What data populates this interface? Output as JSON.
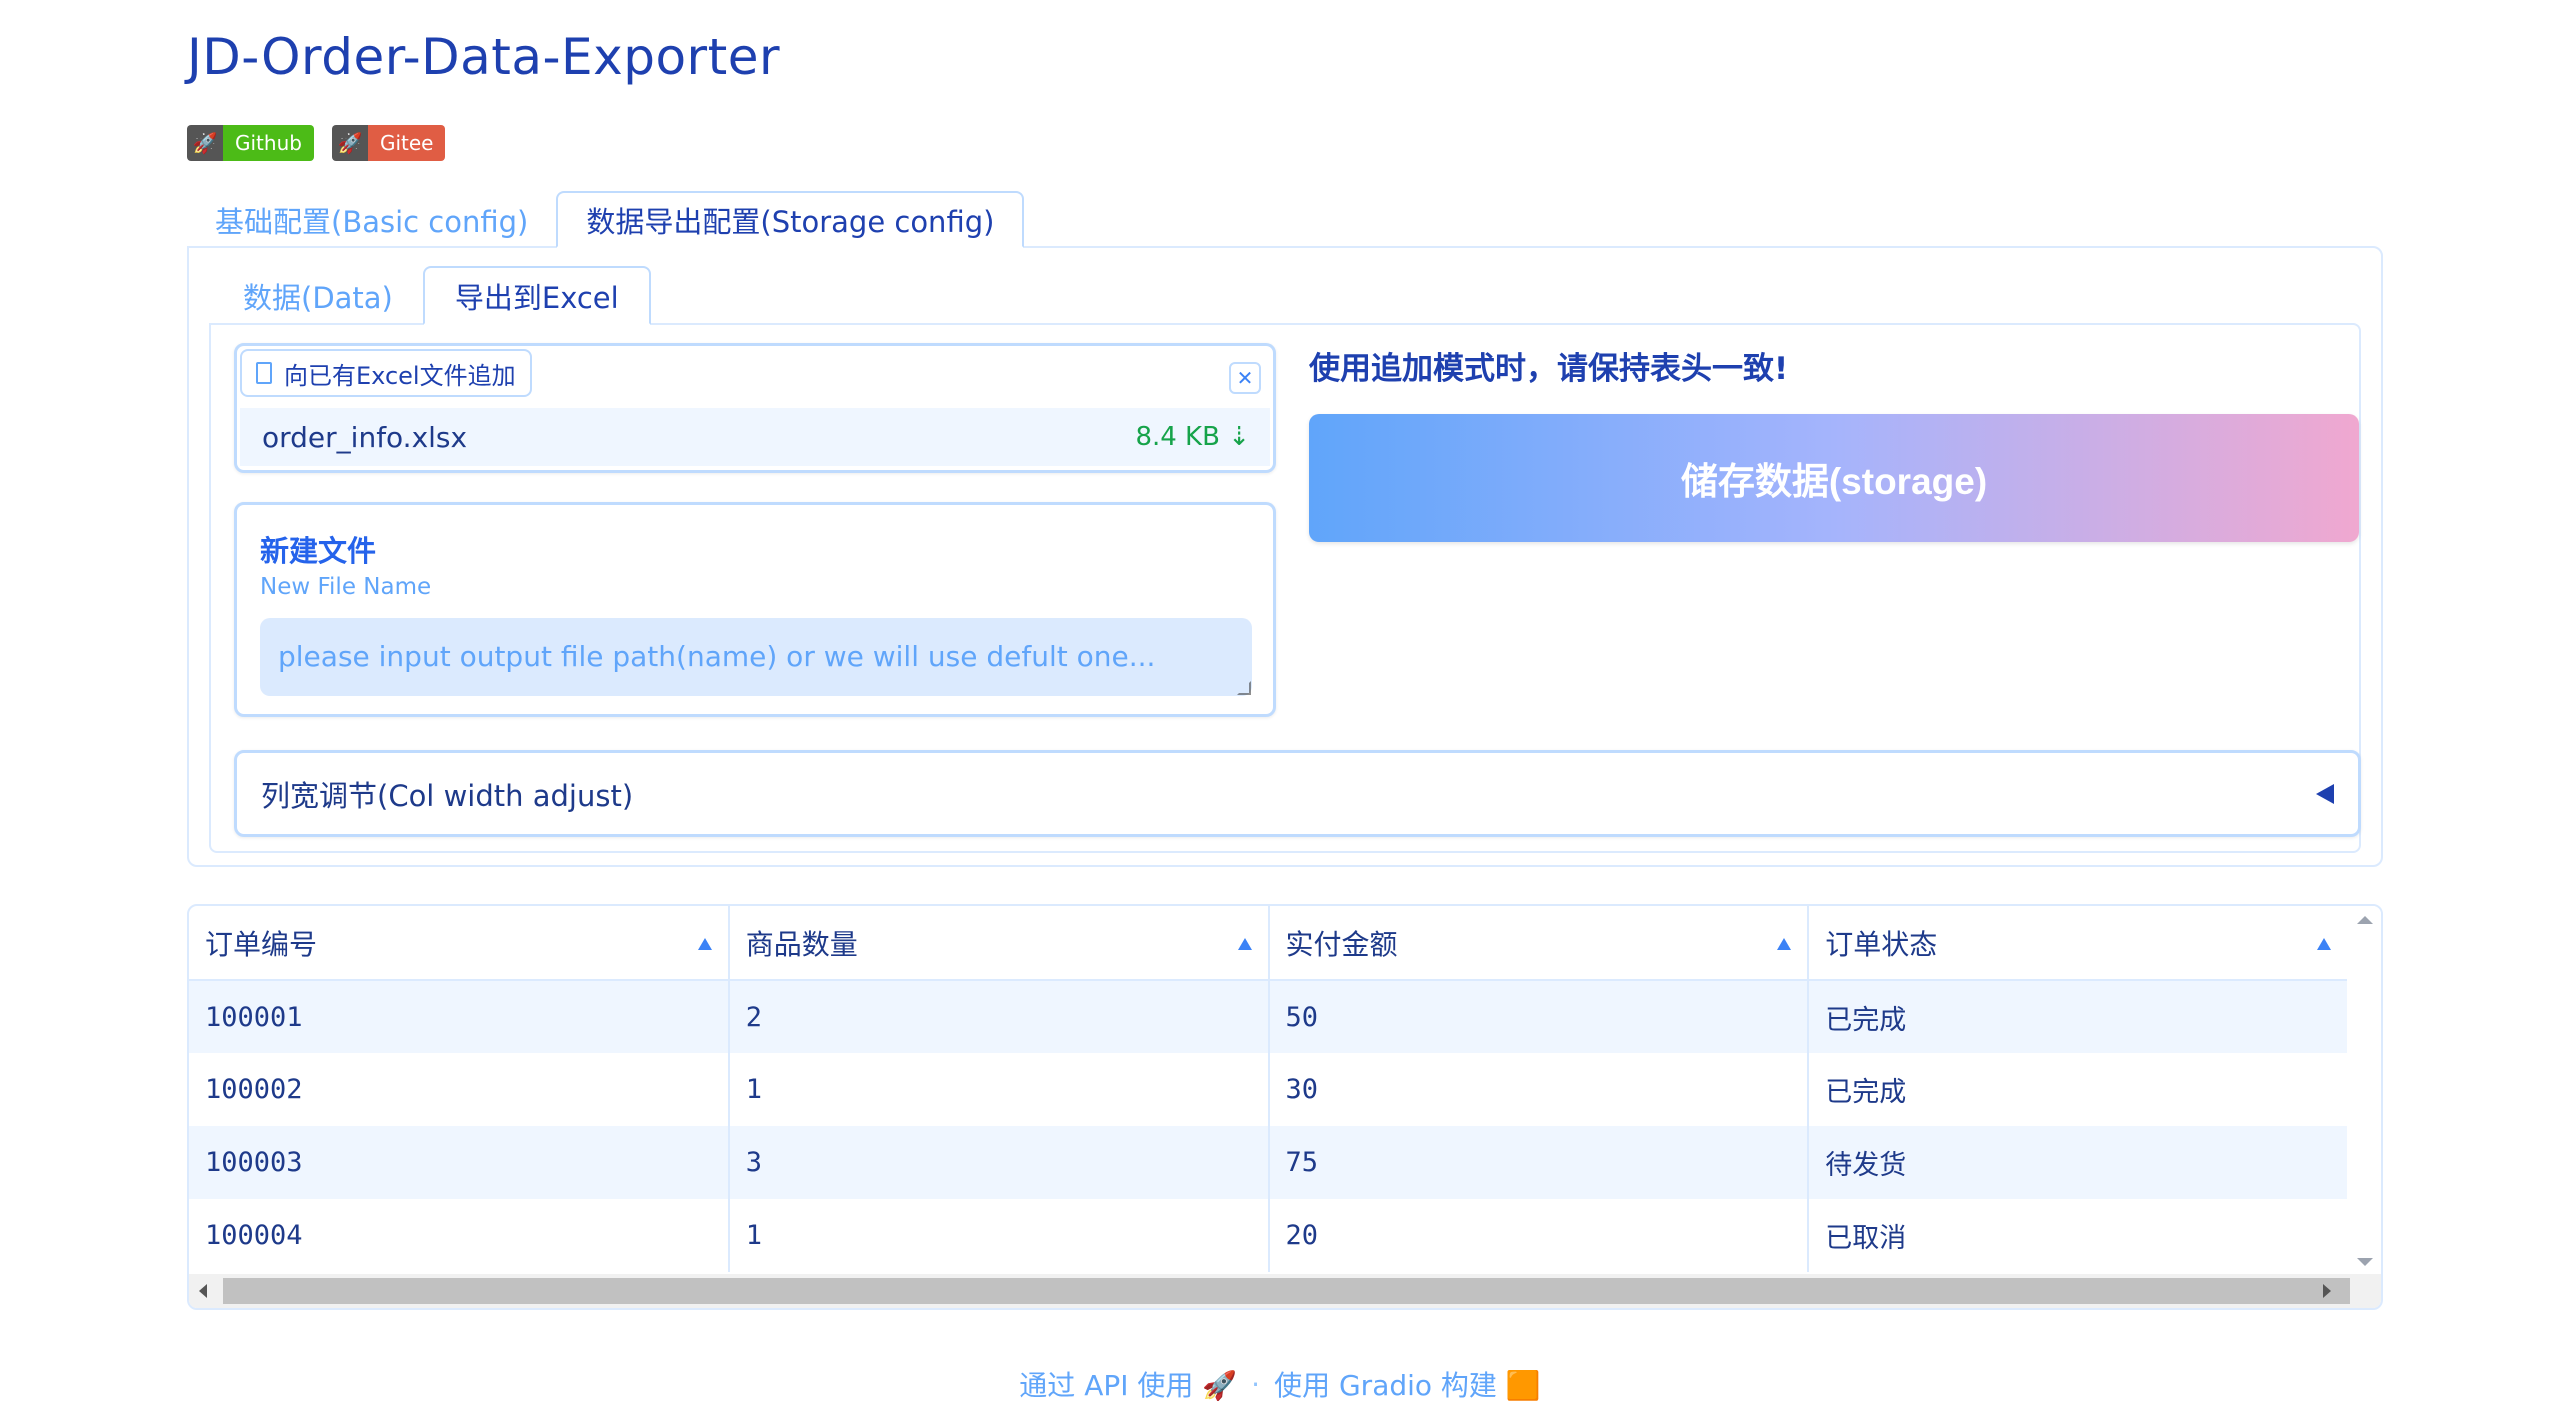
{
  "app": {
    "title": "JD-Order-Data-Exporter"
  },
  "badges": [
    {
      "label": "Github",
      "color": "#4cbb17",
      "icon": "rocket-icon"
    },
    {
      "label": "Gitee",
      "color": "#e05d44",
      "icon": "rocket-icon"
    }
  ],
  "tabs": [
    {
      "label": "基础配置(Basic config)",
      "active": false
    },
    {
      "label": "数据导出配置(Storage config)",
      "active": true
    }
  ],
  "subtabs": [
    {
      "label": "数据(Data)",
      "active": false
    },
    {
      "label": "导出到Excel",
      "active": true
    }
  ],
  "append_file": {
    "label": "向已有Excel文件追加",
    "file_name": "order_info.xlsx",
    "file_size": "8.4 KB ⇣"
  },
  "new_file": {
    "title": "新建文件",
    "subtitle": "New File Name",
    "placeholder": "please input output file path(name) or we will use defult one..."
  },
  "note": "使用追加模式时，请保持表头一致!",
  "storage_button": "储存数据(storage)",
  "col_width": {
    "label": "列宽调节(Col width adjust)",
    "expanded": false
  },
  "table": {
    "headers": [
      "订单编号",
      "商品数量",
      "实付金额",
      "订单状态"
    ],
    "rows": [
      [
        "100001",
        "2",
        "50",
        "已完成"
      ],
      [
        "100002",
        "1",
        "30",
        "已完成"
      ],
      [
        "100003",
        "3",
        "75",
        "待发货"
      ],
      [
        "100004",
        "1",
        "20",
        "已取消"
      ]
    ]
  },
  "footer": {
    "api": "通过 API 使用 🚀",
    "sep": "·",
    "built": "使用 Gradio 构建 🟧"
  },
  "colors": {
    "accent": "#1e40af",
    "link": "#60a5fa",
    "border": "#bfdbfe"
  }
}
